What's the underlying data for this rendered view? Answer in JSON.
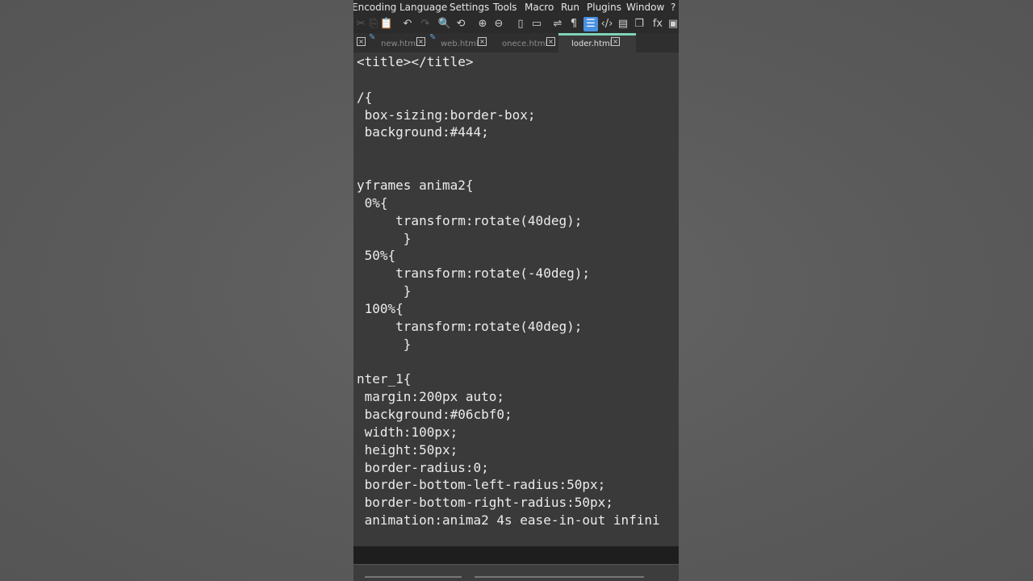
{
  "menubar": {
    "items": [
      "Encoding",
      "Language",
      "Settings",
      "Tools",
      "Macro",
      "Run",
      "Plugins",
      "Window",
      "?"
    ]
  },
  "toolbar": {
    "icons": [
      {
        "name": "cut-icon",
        "glyph": "✂",
        "state": "disabled"
      },
      {
        "name": "copy-icon",
        "glyph": "⎘",
        "state": "disabled"
      },
      {
        "name": "paste-icon",
        "glyph": "📋",
        "state": "disabled"
      },
      {
        "name": "undo-icon",
        "glyph": "↶",
        "state": "normal"
      },
      {
        "name": "redo-icon",
        "glyph": "↷",
        "state": "disabled"
      },
      {
        "name": "find-icon",
        "glyph": "🔍",
        "state": "normal"
      },
      {
        "name": "replace-icon",
        "glyph": "⟲",
        "state": "normal"
      },
      {
        "name": "zoom-in-icon",
        "glyph": "⊕",
        "state": "normal"
      },
      {
        "name": "zoom-out-icon",
        "glyph": "⊖",
        "state": "normal"
      },
      {
        "name": "sync-vertical-icon",
        "glyph": "▯",
        "state": "normal"
      },
      {
        "name": "sync-horizontal-icon",
        "glyph": "▭",
        "state": "normal"
      },
      {
        "name": "word-wrap-icon",
        "glyph": "⇌",
        "state": "normal"
      },
      {
        "name": "show-all-characters-icon",
        "glyph": "¶",
        "state": "normal"
      },
      {
        "name": "indent-guide-icon",
        "glyph": "☰",
        "state": "active"
      },
      {
        "name": "code-icon",
        "glyph": "‹/›",
        "state": "normal"
      },
      {
        "name": "document-map-icon",
        "glyph": "▤",
        "state": "normal"
      },
      {
        "name": "document-list-icon",
        "glyph": "❐",
        "state": "normal"
      },
      {
        "name": "function-list-icon",
        "glyph": "fx",
        "state": "normal"
      },
      {
        "name": "monitor-icon",
        "glyph": "▣",
        "state": "normal"
      }
    ]
  },
  "tabs": [
    {
      "label": "new.html",
      "modified": true,
      "active": false
    },
    {
      "label": "web.html",
      "modified": true,
      "active": false
    },
    {
      "label": "onece.html",
      "modified": false,
      "active": false
    },
    {
      "label": "loder.html",
      "modified": false,
      "active": true
    }
  ],
  "editor": {
    "lines": [
      "<title></title>",
      "",
      "/{",
      " box-sizing:border-box;",
      " background:#444;",
      "",
      "",
      "yframes anima2{",
      " 0%{",
      "     transform:rotate(40deg);",
      "      }",
      " 50%{",
      "     transform:rotate(-40deg);",
      "      }",
      " 100%{",
      "     transform:rotate(40deg);",
      "      }",
      "",
      "nter_1{",
      " margin:200px auto;",
      " background:#06cbf0;",
      " width:100px;",
      " height:50px;",
      " border-radius:0;",
      " border-bottom-left-radius:50px;",
      " border-bottom-right-radius:50px;",
      " animation:anima2 4s ease-in-out infini"
    ]
  },
  "colors": {
    "editor_background": "#3a3a3a",
    "text": "#ececec",
    "active_tab_accent": "#7fd3b8",
    "active_tool": "#4a90e2"
  }
}
